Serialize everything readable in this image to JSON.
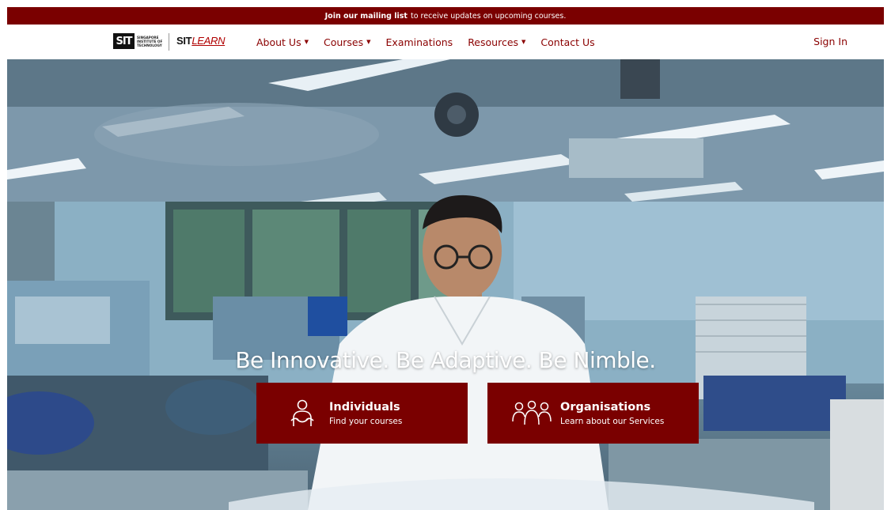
{
  "announcement": {
    "link_text": "Join our mailing list",
    "rest_text": "to receive updates on upcoming courses."
  },
  "brand": {
    "sit_mark": "SIT",
    "sit_fullname": "SINGAPORE INSTITUTE OF TECHNOLOGY",
    "learn_part1": "SIT",
    "learn_part2": "LEARN"
  },
  "nav": {
    "items": [
      {
        "label": "About Us",
        "dropdown": true
      },
      {
        "label": "Courses",
        "dropdown": true
      },
      {
        "label": "Examinations",
        "dropdown": false
      },
      {
        "label": "Resources",
        "dropdown": true
      },
      {
        "label": "Contact Us",
        "dropdown": false
      }
    ],
    "caret": "▼",
    "signin": "Sign In"
  },
  "hero": {
    "tagline": "Be Innovative. Be Adaptive. Be Nimble.",
    "cards": [
      {
        "title": "Individuals",
        "subtitle": "Find your courses",
        "icon": "person-icon"
      },
      {
        "title": "Organisations",
        "subtitle": "Learn about our Services",
        "icon": "group-icon"
      }
    ]
  },
  "colors": {
    "brand_red": "#7a0000",
    "nav_text": "#8a0000"
  }
}
